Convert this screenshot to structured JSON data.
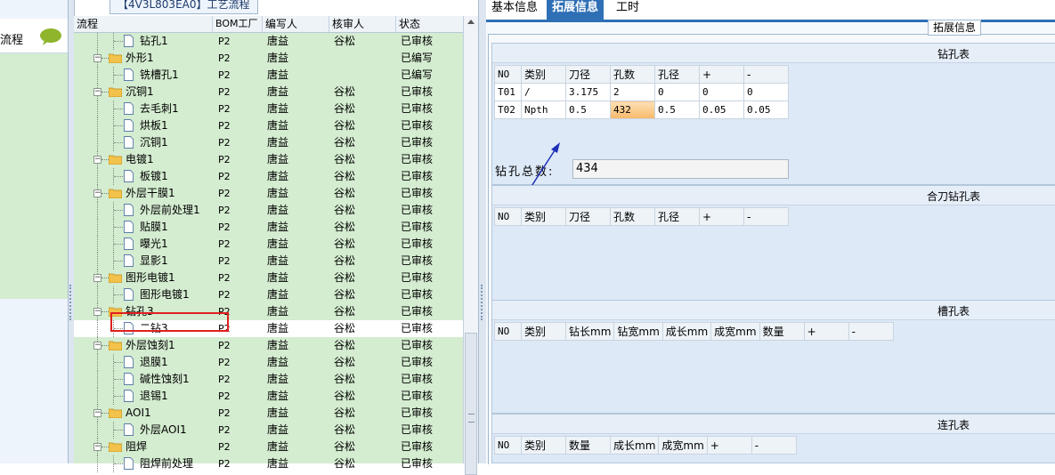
{
  "left_nav": {
    "item_label": "流程"
  },
  "panel": {
    "title": "【4V3L803EA0】工艺流程"
  },
  "tree": {
    "columns": [
      "流程",
      "BOM工厂",
      "编写人",
      "核审人",
      "状态"
    ],
    "rows": [
      {
        "label": "钻孔1",
        "level": 2,
        "icon": "doc",
        "bom": "P2",
        "author": "唐益",
        "reviewer": "谷松",
        "status": "已审核"
      },
      {
        "label": "外形1",
        "level": 1,
        "icon": "folder",
        "bom": "P2",
        "author": "唐益",
        "reviewer": "",
        "status": "已编写"
      },
      {
        "label": "铣槽孔1",
        "level": 2,
        "icon": "doc",
        "bom": "P2",
        "author": "唐益",
        "reviewer": "",
        "status": "已编写"
      },
      {
        "label": "沉铜1",
        "level": 1,
        "icon": "folder",
        "bom": "P2",
        "author": "唐益",
        "reviewer": "谷松",
        "status": "已审核"
      },
      {
        "label": "去毛刺1",
        "level": 2,
        "icon": "doc",
        "bom": "P2",
        "author": "唐益",
        "reviewer": "谷松",
        "status": "已审核"
      },
      {
        "label": "烘板1",
        "level": 2,
        "icon": "doc",
        "bom": "P2",
        "author": "唐益",
        "reviewer": "谷松",
        "status": "已审核"
      },
      {
        "label": "沉铜1",
        "level": 2,
        "icon": "doc",
        "bom": "P2",
        "author": "唐益",
        "reviewer": "谷松",
        "status": "已审核"
      },
      {
        "label": "电镀1",
        "level": 1,
        "icon": "folder",
        "bom": "P2",
        "author": "唐益",
        "reviewer": "谷松",
        "status": "已审核"
      },
      {
        "label": "板镀1",
        "level": 2,
        "icon": "doc",
        "bom": "P2",
        "author": "唐益",
        "reviewer": "谷松",
        "status": "已审核"
      },
      {
        "label": "外层干膜1",
        "level": 1,
        "icon": "folder",
        "bom": "P2",
        "author": "唐益",
        "reviewer": "谷松",
        "status": "已审核"
      },
      {
        "label": "外层前处理1",
        "level": 2,
        "icon": "doc",
        "bom": "P2",
        "author": "唐益",
        "reviewer": "谷松",
        "status": "已审核"
      },
      {
        "label": "贴膜1",
        "level": 2,
        "icon": "doc",
        "bom": "P2",
        "author": "唐益",
        "reviewer": "谷松",
        "status": "已审核"
      },
      {
        "label": "曝光1",
        "level": 2,
        "icon": "doc",
        "bom": "P2",
        "author": "唐益",
        "reviewer": "谷松",
        "status": "已审核"
      },
      {
        "label": "显影1",
        "level": 2,
        "icon": "doc",
        "bom": "P2",
        "author": "唐益",
        "reviewer": "谷松",
        "status": "已审核"
      },
      {
        "label": "图形电镀1",
        "level": 1,
        "icon": "folder",
        "bom": "P2",
        "author": "唐益",
        "reviewer": "谷松",
        "status": "已审核"
      },
      {
        "label": "图形电镀1",
        "level": 2,
        "icon": "doc",
        "bom": "P2",
        "author": "唐益",
        "reviewer": "谷松",
        "status": "已审核"
      },
      {
        "label": "钻孔3",
        "level": 1,
        "icon": "folder",
        "bom": "P2",
        "author": "唐益",
        "reviewer": "谷松",
        "status": "已审核"
      },
      {
        "label": "二钻3",
        "level": 2,
        "icon": "doc",
        "bom": "P2",
        "author": "唐益",
        "reviewer": "谷松",
        "status": "已审核",
        "selected": true
      },
      {
        "label": "外层蚀刻1",
        "level": 1,
        "icon": "folder",
        "bom": "P2",
        "author": "唐益",
        "reviewer": "谷松",
        "status": "已审核"
      },
      {
        "label": "退膜1",
        "level": 2,
        "icon": "doc",
        "bom": "P2",
        "author": "唐益",
        "reviewer": "谷松",
        "status": "已审核"
      },
      {
        "label": "碱性蚀刻1",
        "level": 2,
        "icon": "doc",
        "bom": "P2",
        "author": "唐益",
        "reviewer": "谷松",
        "status": "已审核"
      },
      {
        "label": "退锡1",
        "level": 2,
        "icon": "doc",
        "bom": "P2",
        "author": "唐益",
        "reviewer": "谷松",
        "status": "已审核"
      },
      {
        "label": "AOI1",
        "level": 1,
        "icon": "folder",
        "bom": "P2",
        "author": "唐益",
        "reviewer": "谷松",
        "status": "已审核"
      },
      {
        "label": "外层AOI1",
        "level": 2,
        "icon": "doc",
        "bom": "P2",
        "author": "唐益",
        "reviewer": "谷松",
        "status": "已审核"
      },
      {
        "label": "阻焊",
        "level": 1,
        "icon": "folder",
        "bom": "P2",
        "author": "唐益",
        "reviewer": "谷松",
        "status": "已审核"
      },
      {
        "label": "阻焊前处理",
        "level": 2,
        "icon": "doc",
        "bom": "P2",
        "author": "唐益",
        "reviewer": "谷松",
        "status": "已审核"
      }
    ]
  },
  "tabs": [
    {
      "label": "基本信息",
      "active": false
    },
    {
      "label": "拓展信息",
      "active": true
    },
    {
      "label": "工时",
      "active": false
    }
  ],
  "group_title": "拓展信息",
  "drill_table": {
    "title": "钻孔表",
    "headers": [
      "NO",
      "类别",
      "刀径",
      "孔数",
      "孔径",
      "+",
      "-"
    ],
    "rows": [
      [
        "T01",
        "/",
        "3.175",
        "2",
        "0",
        "0",
        "0"
      ],
      [
        "T02",
        "Npth",
        "0.5",
        "432",
        "0.5",
        "0.05",
        "0.05"
      ]
    ],
    "total_label": "钻孔总数:",
    "total_value": "434"
  },
  "combined_drill_table": {
    "title": "合刀钻孔表",
    "headers": [
      "NO",
      "类别",
      "刀径",
      "孔数",
      "孔径",
      "+",
      "-"
    ]
  },
  "slot_table": {
    "title": "槽孔表",
    "headers": [
      "NO",
      "类别",
      "钻长mm",
      "钻宽mm",
      "成长mm",
      "成宽mm",
      "数量",
      "+",
      "-"
    ]
  },
  "linked_hole_table": {
    "title": "连孔表",
    "headers": [
      "NO",
      "类别",
      "数量",
      "成长mm",
      "成宽mm",
      "+",
      "-"
    ]
  },
  "colors": {
    "tree_background": "#d4ecd0",
    "active_tab": "#2f6fb6",
    "highlight_cell": "#fbd29a",
    "selection_box": "#e02020",
    "arrow": "#1e2fb8"
  }
}
